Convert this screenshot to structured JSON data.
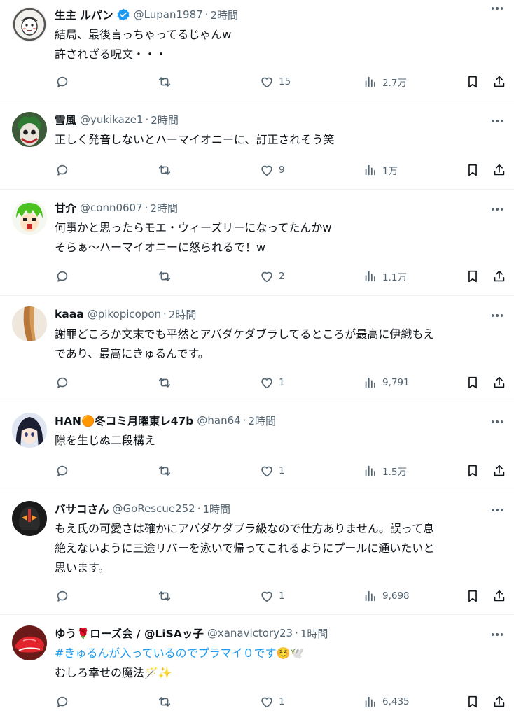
{
  "tweets": [
    {
      "name": "生主 ルパン",
      "verified": true,
      "handle": "@Lupan1987",
      "time": "2時間",
      "lines": [
        "結局、最後言っちゃってるじゃんw",
        "許されざる呪文・・・"
      ],
      "likes": "15",
      "views": "2.7万",
      "avatar": "avatar-drawn-face"
    },
    {
      "name": "雪風",
      "verified": false,
      "handle": "@yukikaze1",
      "time": "2時間",
      "lines": [
        "正しく発音しないとハーマイオニーに、訂正されそう笑"
      ],
      "likes": "9",
      "views": "1万",
      "avatar": "avatar-joker"
    },
    {
      "name": "甘介",
      "verified": false,
      "handle": "@conn0607",
      "time": "2時間",
      "lines": [
        "何事かと思ったらモエ・ウィーズリーになってたんかw",
        "そらぁ～ハーマイオニーに怒られるで！w"
      ],
      "likes": "2",
      "views": "1.1万",
      "avatar": "avatar-green-hair"
    },
    {
      "name": "kaaa",
      "verified": false,
      "handle": "@pikopicopon",
      "time": "2時間",
      "lines": [
        "謝罪どころか文末でも平然とアバダケダブラしてるところが最高に伊織もえ",
        "であり、最高にきゅるんです。"
      ],
      "likes": "1",
      "views": "9,791",
      "avatar": "avatar-hair"
    },
    {
      "name": "HAN🟠冬コミ月曜東レ47b",
      "verified": false,
      "handle": "@han64",
      "time": "2時間",
      "lines": [
        "隙を生じぬ二段構え"
      ],
      "likes": "1",
      "views": "1.5万",
      "avatar": "avatar-anime-girl"
    },
    {
      "name": "バサコさん",
      "verified": false,
      "handle": "@GoRescue252",
      "time": "1時間",
      "lines": [
        "もえ氏の可愛さは確かにアバダケダブラ級なので仕方ありません。誤って息",
        "絶えないように三途リバーを泳いで帰ってこれるようにプールに通いたいと",
        "思います。"
      ],
      "likes": "1",
      "views": "9,698",
      "avatar": "avatar-rider-helmet"
    },
    {
      "name": "ゆう🌹ローズ会 / @LiSAッ子",
      "verified": false,
      "handle": "@xanavictory23",
      "time": "1時間",
      "hashtag": "#きゅるんが入っているのでプラマイ０です",
      "hashtag_tail": "☺️🕊️",
      "lines": [
        "むしろ幸せの魔法🪄✨"
      ],
      "likes": "1",
      "views": "6,435",
      "avatar": "avatar-red-shoes"
    }
  ],
  "colors": {
    "text": "#0f1419",
    "secondary": "#536471",
    "link": "#1d9bf0",
    "verified": "#1d9bf0",
    "divider": "#eff3f4"
  },
  "icons": [
    "reply-icon",
    "retweet-icon",
    "like-icon",
    "views-icon",
    "bookmark-icon",
    "share-icon",
    "more-icon",
    "verified-badge-icon"
  ]
}
